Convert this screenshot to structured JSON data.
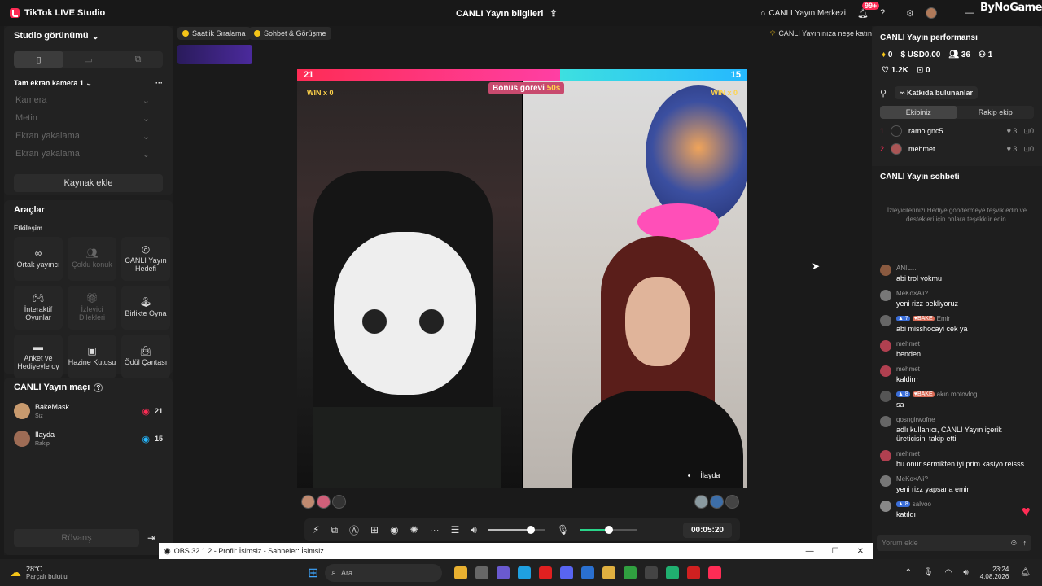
{
  "app": {
    "title": "TikTok LIVE Studio",
    "center_title": "CANLI Yayın bilgileri",
    "center_link": "CANLI Yayın Merkezi",
    "notif_count": "99+",
    "watermark": "ByNoGame"
  },
  "left": {
    "studio_view": "Studio görünümü",
    "camera_title": "Tam ekran kamera 1",
    "sources": [
      "Kamera",
      "Metin",
      "Ekran yakalama",
      "Ekran yakalama"
    ],
    "add_source": "Kaynak ekle",
    "tools_title": "Araçlar",
    "interaction": "Etkileşim",
    "tools": [
      {
        "label": "Ortak yayıncı",
        "disabled": false
      },
      {
        "label": "Çoklu konuk",
        "disabled": true
      },
      {
        "label": "CANLI Yayın Hedefi",
        "disabled": false
      },
      {
        "label": "İnteraktif Oyunlar",
        "disabled": false
      },
      {
        "label": "İzleyici Dilekleri",
        "disabled": true
      },
      {
        "label": "Birlikte Oyna",
        "disabled": false
      },
      {
        "label": "Anket ve Hediyeyle oy",
        "disabled": false
      },
      {
        "label": "Hazine Kutusu",
        "disabled": false
      },
      {
        "label": "Ödül Çantası",
        "disabled": false
      }
    ],
    "match_title": "CANLI Yayın maçı",
    "players": [
      {
        "name": "BakeMask",
        "role": "Siz",
        "score": "21"
      },
      {
        "name": "İlayda",
        "role": "Rakip",
        "score": "15"
      }
    ],
    "rematch": "Rövanş"
  },
  "center": {
    "chip1": "Saatlik Sıralama",
    "chip2": "Sohbet & Görüşme",
    "chip3": "CANLI Yayınınıza neşe katın",
    "score_left": "21",
    "score_right": "15",
    "bonus": "Bonus görevi",
    "bonus_time": "50s",
    "win_left": "WIN x 0",
    "win_right": "WIN x 0",
    "guest_name": "İlayda",
    "timer": "00:05:20",
    "volume_level": 0.75,
    "mic_level": 0.5
  },
  "right": {
    "perf_title": "CANLI Yayın performansı",
    "stats": {
      "diamonds": "0",
      "usd": "USD0.00",
      "viewers": "36",
      "followers": "1",
      "likes": "1.2K",
      "gifts": "0"
    },
    "contributors": "Katkıda bulunanlar",
    "tab_our": "Ekibiniz",
    "tab_rival": "Rakip ekip",
    "ranks": [
      {
        "rank": "1",
        "name": "ramo.gnc5",
        "hearts": "3",
        "gifts": "0"
      },
      {
        "rank": "2",
        "name": "mehmet",
        "hearts": "3",
        "gifts": "0"
      }
    ],
    "chat_title": "CANLI Yayın sohbeti",
    "chat_hint": "İzleyicilerinizi Hediye göndermeye teşvik edin ve destekleri için onlara teşekkür edin.",
    "messages": [
      {
        "name": "ANIL...",
        "text": "abi trol yokmu"
      },
      {
        "name": "MeKo×Ali?",
        "text": "yeni rizz bekliyoruz"
      },
      {
        "name": "Emir",
        "lvl": "7",
        "tag": "BAKE",
        "text": "abi misshocayi cek ya"
      },
      {
        "name": "mehmet",
        "text": "benden"
      },
      {
        "name": "mehmet",
        "text": "kaldirrr"
      },
      {
        "name": "akın motovlog",
        "lvl": "8",
        "tag": "BAKE",
        "text": "sa"
      },
      {
        "name": "qosngirwofne",
        "text": "adlı kullanıcı, CANLI Yayın içerik üreticisini takip etti"
      },
      {
        "name": "mehmet",
        "text": "bu onur sermikten iyi prim kasiyo reisss"
      },
      {
        "name": "MeKo×Ali?",
        "text": "yeni rizz yapsana emir"
      },
      {
        "name": "salvoo",
        "lvl": "8",
        "text": "katıldı"
      }
    ],
    "comment_placeholder": "Yorum ekle"
  },
  "obs": {
    "title": "OBS 32.1.2 - Profil: İsimsiz - Sahneler: İsimsiz"
  },
  "taskbar": {
    "temp": "28°C",
    "weather": "Parçalı bulutlu",
    "search": "Ara",
    "time": "23:24",
    "date": "4.08.2026"
  }
}
